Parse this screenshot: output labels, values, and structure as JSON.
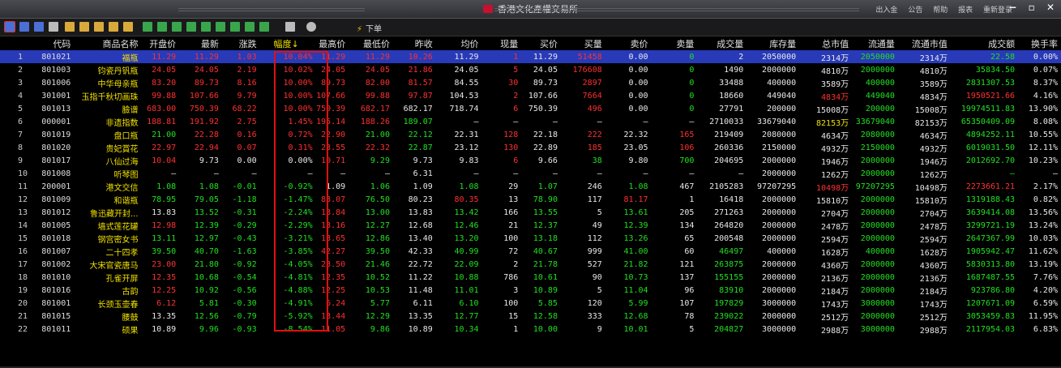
{
  "window": {
    "title": "香港文化產權交易所",
    "links": [
      "出入金",
      "公告",
      "帮助",
      "报表",
      "重新登录"
    ],
    "controls": [
      "−",
      "▫",
      "✕"
    ]
  },
  "toolbar": {
    "order_label": "下单"
  },
  "columns": [
    "",
    "代码",
    "商品名称",
    "开盘价",
    "最新",
    "涨跌",
    "幅度↓",
    "最高价",
    "最低价",
    "昨收",
    "均价",
    "现量",
    "买价",
    "买量",
    "卖价",
    "卖量",
    "成交量",
    "库存量",
    "总市值",
    "流通量",
    "流通市值",
    "成交额",
    "换手率"
  ],
  "rows": [
    [
      "1",
      "801021",
      "福瓶",
      "11.29",
      "11.29",
      "1.03",
      "10.04%",
      "11.29",
      "11.29",
      "10.26",
      "11.29",
      "1",
      "11.29",
      "51458",
      "0.00",
      "0",
      "2",
      "2050000",
      "2314万",
      "2050000",
      "2314万",
      "22.58",
      "0.00%"
    ],
    [
      "2",
      "801003",
      "钧瓷丹钒瓶",
      "24.05",
      "24.05",
      "2.19",
      "10.02%",
      "24.05",
      "24.05",
      "21.86",
      "24.05",
      "5",
      "24.05",
      "176608",
      "0.00",
      "0",
      "1490",
      "2000000",
      "4810万",
      "2000000",
      "4810万",
      "35834.50",
      "0.07%"
    ],
    [
      "3",
      "801006",
      "中华母亲瓶",
      "83.20",
      "89.73",
      "8.16",
      "10.00%",
      "89.73",
      "82.00",
      "81.57",
      "84.55",
      "30",
      "89.73",
      "2897",
      "0.00",
      "0",
      "33488",
      "400000",
      "3589万",
      "400000",
      "3589万",
      "2831307.53",
      "8.37%"
    ],
    [
      "4",
      "301001",
      "玉指千秋切画珠",
      "99.88",
      "107.66",
      "9.79",
      "10.00%",
      "107.66",
      "99.88",
      "97.87",
      "104.53",
      "2",
      "107.66",
      "7664",
      "0.00",
      "0",
      "18660",
      "449040",
      "4834万",
      "449040",
      "4834万",
      "1950521.66",
      "4.16%"
    ],
    [
      "5",
      "801013",
      "臉谱",
      "683.00",
      "750.39",
      "68.22",
      "10.00%",
      "750.39",
      "682.17",
      "682.17",
      "718.74",
      "6",
      "750.39",
      "496",
      "0.00",
      "0",
      "27791",
      "200000",
      "15008万",
      "200000",
      "15008万",
      "19974511.83",
      "13.90%"
    ],
    [
      "6",
      "000001",
      "非遗指数",
      "188.81",
      "191.92",
      "2.75",
      "1.45%",
      "195.14",
      "188.26",
      "189.07",
      "—",
      "—",
      "—",
      "—",
      "—",
      "—",
      "2710033",
      "33679040",
      "82153万",
      "33679040",
      "82153万",
      "65350409.09",
      "8.08%"
    ],
    [
      "7",
      "801019",
      "盘口瓶",
      "21.00",
      "22.28",
      "0.16",
      "0.72%",
      "22.90",
      "21.00",
      "22.12",
      "22.31",
      "128",
      "22.18",
      "222",
      "22.32",
      "165",
      "219409",
      "2080000",
      "4634万",
      "2080000",
      "4634万",
      "4894252.11",
      "10.55%"
    ],
    [
      "8",
      "801020",
      "贵妃賞花",
      "22.97",
      "22.94",
      "0.07",
      "0.31%",
      "23.55",
      "22.32",
      "22.87",
      "23.12",
      "130",
      "22.89",
      "185",
      "23.05",
      "106",
      "260336",
      "2150000",
      "4932万",
      "2150000",
      "4932万",
      "6019031.50",
      "12.11%"
    ],
    [
      "9",
      "801017",
      "八仙过海",
      "10.04",
      "9.73",
      "0.00",
      "0.00%",
      "10.71",
      "9.29",
      "9.73",
      "9.83",
      "6",
      "9.66",
      "38",
      "9.80",
      "700",
      "204695",
      "2000000",
      "1946万",
      "2000000",
      "1946万",
      "2012692.70",
      "10.23%"
    ],
    [
      "10",
      "801008",
      "听琴图",
      "—",
      "—",
      "—",
      "—",
      "—",
      "—",
      "6.31",
      "—",
      "—",
      "—",
      "—",
      "—",
      "—",
      "—",
      "2000000",
      "1262万",
      "2000000",
      "1262万",
      "—",
      "—"
    ],
    [
      "11",
      "200001",
      "港文交信",
      "1.08",
      "1.08",
      "-0.01",
      "-0.92%",
      "1.09",
      "1.06",
      "1.09",
      "1.08",
      "29",
      "1.07",
      "246",
      "1.08",
      "467",
      "2105283",
      "97207295",
      "10498万",
      "97207295",
      "10498万",
      "2273661.21",
      "2.17%"
    ],
    [
      "12",
      "801009",
      "和谐瓶",
      "78.95",
      "79.05",
      "-1.18",
      "-1.47%",
      "83.07",
      "76.50",
      "80.23",
      "80.35",
      "13",
      "78.90",
      "117",
      "81.17",
      "1",
      "16418",
      "2000000",
      "15810万",
      "2000000",
      "15810万",
      "1319188.43",
      "0.82%"
    ],
    [
      "13",
      "801012",
      "鲁迅藏开封...",
      "13.83",
      "13.52",
      "-0.31",
      "-2.24%",
      "13.84",
      "13.00",
      "13.83",
      "13.42",
      "166",
      "13.55",
      "5",
      "13.61",
      "205",
      "271263",
      "2000000",
      "2704万",
      "2000000",
      "2704万",
      "3639414.08",
      "13.56%"
    ],
    [
      "14",
      "801005",
      "墙式莲花罐",
      "12.98",
      "12.39",
      "-0.29",
      "-2.29%",
      "13.16",
      "12.27",
      "12.68",
      "12.46",
      "21",
      "12.37",
      "49",
      "12.39",
      "134",
      "264820",
      "2000000",
      "2478万",
      "2000000",
      "2478万",
      "3299721.19",
      "13.24%"
    ],
    [
      "15",
      "801018",
      "钢宫密女书",
      "13.11",
      "12.97",
      "-0.43",
      "-3.21%",
      "13.65",
      "12.86",
      "13.40",
      "13.20",
      "100",
      "13.18",
      "112",
      "13.26",
      "65",
      "200548",
      "2000000",
      "2594万",
      "2000000",
      "2594万",
      "2647367.99",
      "10.03%"
    ],
    [
      "16",
      "801007",
      "二十四孝",
      "39.50",
      "40.70",
      "-1.63",
      "-3.85%",
      "42.27",
      "39.50",
      "42.33",
      "40.99",
      "72",
      "40.67",
      "999",
      "41.00",
      "60",
      "46497",
      "400000",
      "1628万",
      "400000",
      "1628万",
      "1905942.47",
      "11.62%"
    ],
    [
      "17",
      "801002",
      "大宋官瓷唐马",
      "23.00",
      "21.80",
      "-0.92",
      "-4.05%",
      "23.50",
      "21.46",
      "22.72",
      "22.09",
      "2",
      "21.78",
      "527",
      "21.82",
      "121",
      "263875",
      "2000000",
      "4360万",
      "2000000",
      "4360万",
      "5830313.80",
      "13.19%"
    ],
    [
      "18",
      "801010",
      "孔雀开屏",
      "12.35",
      "10.68",
      "-0.54",
      "-4.81%",
      "12.35",
      "10.52",
      "11.22",
      "10.88",
      "786",
      "10.61",
      "90",
      "10.73",
      "137",
      "155155",
      "2000000",
      "2136万",
      "2000000",
      "2136万",
      "1687487.55",
      "7.76%"
    ],
    [
      "19",
      "801016",
      "古韵",
      "12.25",
      "10.92",
      "-0.56",
      "-4.88%",
      "12.25",
      "10.53",
      "11.48",
      "11.01",
      "3",
      "10.89",
      "5",
      "11.04",
      "96",
      "83910",
      "2000000",
      "2184万",
      "2000000",
      "2184万",
      "923786.80",
      "4.20%"
    ],
    [
      "20",
      "801001",
      "长颈玉壶春",
      "6.12",
      "5.81",
      "-0.30",
      "-4.91%",
      "6.24",
      "5.77",
      "6.11",
      "6.10",
      "100",
      "5.85",
      "120",
      "5.99",
      "107",
      "197829",
      "3000000",
      "1743万",
      "3000000",
      "1743万",
      "1207671.09",
      "6.59%"
    ],
    [
      "21",
      "801015",
      "腰鼓",
      "13.35",
      "12.56",
      "-0.79",
      "-5.92%",
      "13.44",
      "12.29",
      "13.35",
      "12.77",
      "15",
      "12.58",
      "333",
      "12.68",
      "78",
      "239022",
      "2000000",
      "2512万",
      "2000000",
      "2512万",
      "3053459.83",
      "11.95%"
    ],
    [
      "22",
      "801011",
      "硕果",
      "10.89",
      "9.96",
      "-0.93",
      "-8.54%",
      "11.05",
      "9.86",
      "10.89",
      "10.34",
      "1",
      "10.00",
      "9",
      "10.01",
      "5",
      "204827",
      "3000000",
      "2988万",
      "3000000",
      "2988万",
      "2117954.03",
      "6.83%"
    ]
  ],
  "row_colors": [
    [
      "r",
      "r",
      "r",
      "r",
      "r",
      "r",
      "r",
      "w",
      "r",
      "w",
      "r",
      "w",
      "g",
      "w",
      "w",
      "w",
      "g",
      "w",
      "g",
      "w",
      "w",
      "r"
    ],
    [
      "r",
      "r",
      "r",
      "r",
      "r",
      "r",
      "r",
      "w",
      "r",
      "w",
      "r",
      "w",
      "g",
      "w",
      "w",
      "w",
      "g",
      "w",
      "g",
      "w",
      "w",
      "r"
    ],
    [
      "r",
      "r",
      "r",
      "r",
      "r",
      "r",
      "r",
      "w",
      "r",
      "w",
      "r",
      "w",
      "g",
      "w",
      "w",
      "w",
      "g",
      "w",
      "g",
      "w",
      "w",
      "r"
    ],
    [
      "r",
      "r",
      "r",
      "r",
      "r",
      "r",
      "r",
      "w",
      "r",
      "w",
      "r",
      "w",
      "g",
      "w",
      "w",
      "r",
      "g",
      "w",
      "r",
      "w",
      "w",
      "r"
    ],
    [
      "r",
      "r",
      "r",
      "r",
      "r",
      "r",
      "w",
      "w",
      "r",
      "w",
      "r",
      "w",
      "g",
      "w",
      "w",
      "w",
      "g",
      "w",
      "g",
      "w",
      "w",
      "r"
    ],
    [
      "r",
      "r",
      "r",
      "r",
      "r",
      "r",
      "g",
      "w",
      "w",
      "w",
      "w",
      "w",
      "w",
      "w",
      "w",
      "y",
      "g",
      "w",
      "g",
      "w",
      "w",
      "r"
    ],
    [
      "g",
      "r",
      "r",
      "r",
      "r",
      "g",
      "g",
      "w",
      "r",
      "w",
      "r",
      "w",
      "r",
      "w",
      "w",
      "w",
      "g",
      "w",
      "g",
      "w",
      "w",
      "r"
    ],
    [
      "r",
      "r",
      "r",
      "r",
      "r",
      "r",
      "g",
      "w",
      "r",
      "w",
      "r",
      "w",
      "r",
      "w",
      "w",
      "w",
      "g",
      "w",
      "g",
      "w",
      "w",
      "r"
    ],
    [
      "r",
      "w",
      "w",
      "w",
      "r",
      "g",
      "w",
      "w",
      "r",
      "w",
      "g",
      "w",
      "g",
      "w",
      "w",
      "w",
      "g",
      "w",
      "g",
      "w",
      "w",
      "r"
    ],
    [
      "w",
      "w",
      "w",
      "w",
      "w",
      "w",
      "w",
      "w",
      "w",
      "w",
      "w",
      "w",
      "w",
      "w",
      "w",
      "w",
      "g",
      "w",
      "g",
      "w",
      "w",
      "w"
    ],
    [
      "g",
      "g",
      "g",
      "g",
      "w",
      "g",
      "w",
      "g",
      "w",
      "g",
      "w",
      "g",
      "w",
      "w",
      "w",
      "r",
      "g",
      "w",
      "r",
      "w",
      "w",
      "r"
    ],
    [
      "g",
      "g",
      "g",
      "g",
      "r",
      "g",
      "w",
      "r",
      "w",
      "g",
      "w",
      "r",
      "w",
      "w",
      "w",
      "w",
      "g",
      "w",
      "g",
      "w",
      "w",
      "r"
    ],
    [
      "w",
      "g",
      "g",
      "g",
      "r",
      "g",
      "w",
      "g",
      "w",
      "g",
      "w",
      "g",
      "w",
      "w",
      "w",
      "w",
      "g",
      "w",
      "g",
      "w",
      "w",
      "r"
    ],
    [
      "r",
      "g",
      "g",
      "g",
      "r",
      "g",
      "w",
      "g",
      "w",
      "g",
      "w",
      "g",
      "w",
      "w",
      "w",
      "w",
      "g",
      "w",
      "g",
      "w",
      "w",
      "r"
    ],
    [
      "g",
      "g",
      "g",
      "g",
      "r",
      "g",
      "w",
      "g",
      "w",
      "g",
      "w",
      "g",
      "w",
      "w",
      "w",
      "w",
      "g",
      "w",
      "g",
      "w",
      "w",
      "r"
    ],
    [
      "g",
      "g",
      "g",
      "g",
      "r",
      "g",
      "w",
      "g",
      "w",
      "g",
      "w",
      "g",
      "w",
      "g",
      "w",
      "w",
      "g",
      "w",
      "g",
      "w",
      "w",
      "r"
    ],
    [
      "r",
      "g",
      "g",
      "g",
      "r",
      "g",
      "w",
      "g",
      "w",
      "g",
      "w",
      "g",
      "w",
      "g",
      "w",
      "w",
      "g",
      "w",
      "g",
      "w",
      "w",
      "r"
    ],
    [
      "r",
      "g",
      "g",
      "g",
      "r",
      "g",
      "w",
      "g",
      "w",
      "g",
      "w",
      "g",
      "w",
      "g",
      "w",
      "w",
      "g",
      "w",
      "g",
      "w",
      "w",
      "r"
    ],
    [
      "r",
      "g",
      "g",
      "g",
      "r",
      "g",
      "w",
      "g",
      "w",
      "g",
      "w",
      "g",
      "w",
      "g",
      "w",
      "w",
      "g",
      "w",
      "g",
      "w",
      "w",
      "r"
    ],
    [
      "r",
      "g",
      "g",
      "g",
      "r",
      "g",
      "w",
      "g",
      "w",
      "g",
      "w",
      "g",
      "w",
      "g",
      "w",
      "w",
      "g",
      "w",
      "g",
      "w",
      "w",
      "r"
    ],
    [
      "w",
      "g",
      "g",
      "g",
      "r",
      "g",
      "w",
      "g",
      "w",
      "g",
      "w",
      "g",
      "w",
      "g",
      "w",
      "w",
      "g",
      "w",
      "g",
      "w",
      "w",
      "r"
    ],
    [
      "w",
      "g",
      "g",
      "g",
      "r",
      "g",
      "w",
      "g",
      "w",
      "g",
      "w",
      "g",
      "w",
      "g",
      "w",
      "w",
      "g",
      "w",
      "g",
      "w",
      "w",
      "r"
    ]
  ],
  "colors": {
    "up": "#ff3030",
    "down": "#20e020",
    "neutral": "#e8e8e8",
    "selection": "#283ab8",
    "highlight_box": "#e01010"
  }
}
